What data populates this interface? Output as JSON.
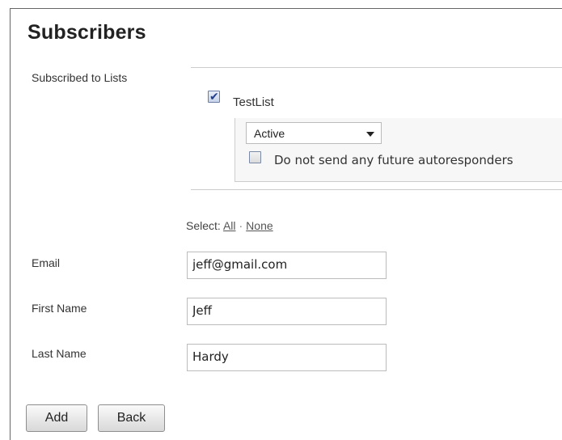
{
  "page": {
    "title": "Subscribers"
  },
  "lists_section": {
    "label": "Subscribed to Lists",
    "lists": [
      {
        "name": "TestList",
        "checked": true,
        "status": {
          "selected": "Active"
        },
        "no_autoresponders": {
          "label": "Do not send any future autoresponders",
          "checked": false
        }
      }
    ],
    "select": {
      "prefix": "Select:",
      "all_label": "All",
      "separator": "·",
      "none_label": "None"
    }
  },
  "fields": {
    "email": {
      "label": "Email",
      "value": "jeff@gmail.com"
    },
    "first_name": {
      "label": "First Name",
      "value": "Jeff"
    },
    "last_name": {
      "label": "Last Name",
      "value": "Hardy"
    }
  },
  "buttons": {
    "add_label": "Add",
    "back_label": "Back"
  },
  "icons": {
    "checkbox_checked": "checkbox-checked-icon",
    "checkbox_unchecked": "checkbox-unchecked-icon",
    "dropdown": "caret-down-icon"
  }
}
